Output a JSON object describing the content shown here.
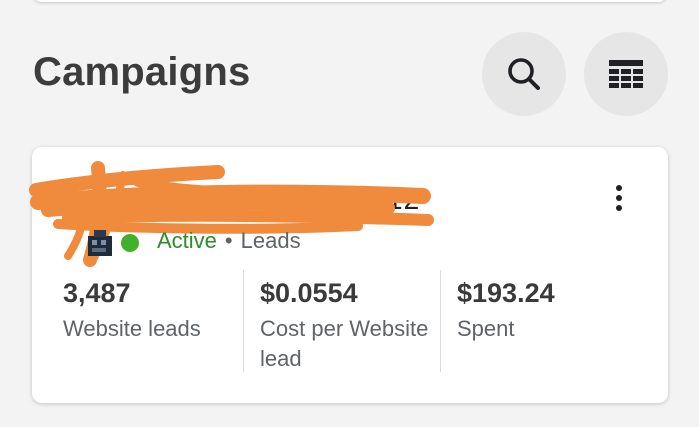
{
  "header": {
    "title": "Campaigns",
    "search_icon": "search-icon",
    "table_icon": "table-view-icon"
  },
  "campaign": {
    "name_visible": "12",
    "redaction_color": "#f08a3c",
    "status": "Active",
    "status_color": "#43b02a",
    "separator": "•",
    "objective": "Leads",
    "metrics": [
      {
        "value": "3,487",
        "label": "Website leads"
      },
      {
        "value": "$0.0554",
        "label": "Cost per Website lead"
      },
      {
        "value": "$193.24",
        "label": "Spent"
      }
    ]
  },
  "icons": {
    "more": "more-vertical-icon",
    "brand": "brand-logo-icon"
  }
}
